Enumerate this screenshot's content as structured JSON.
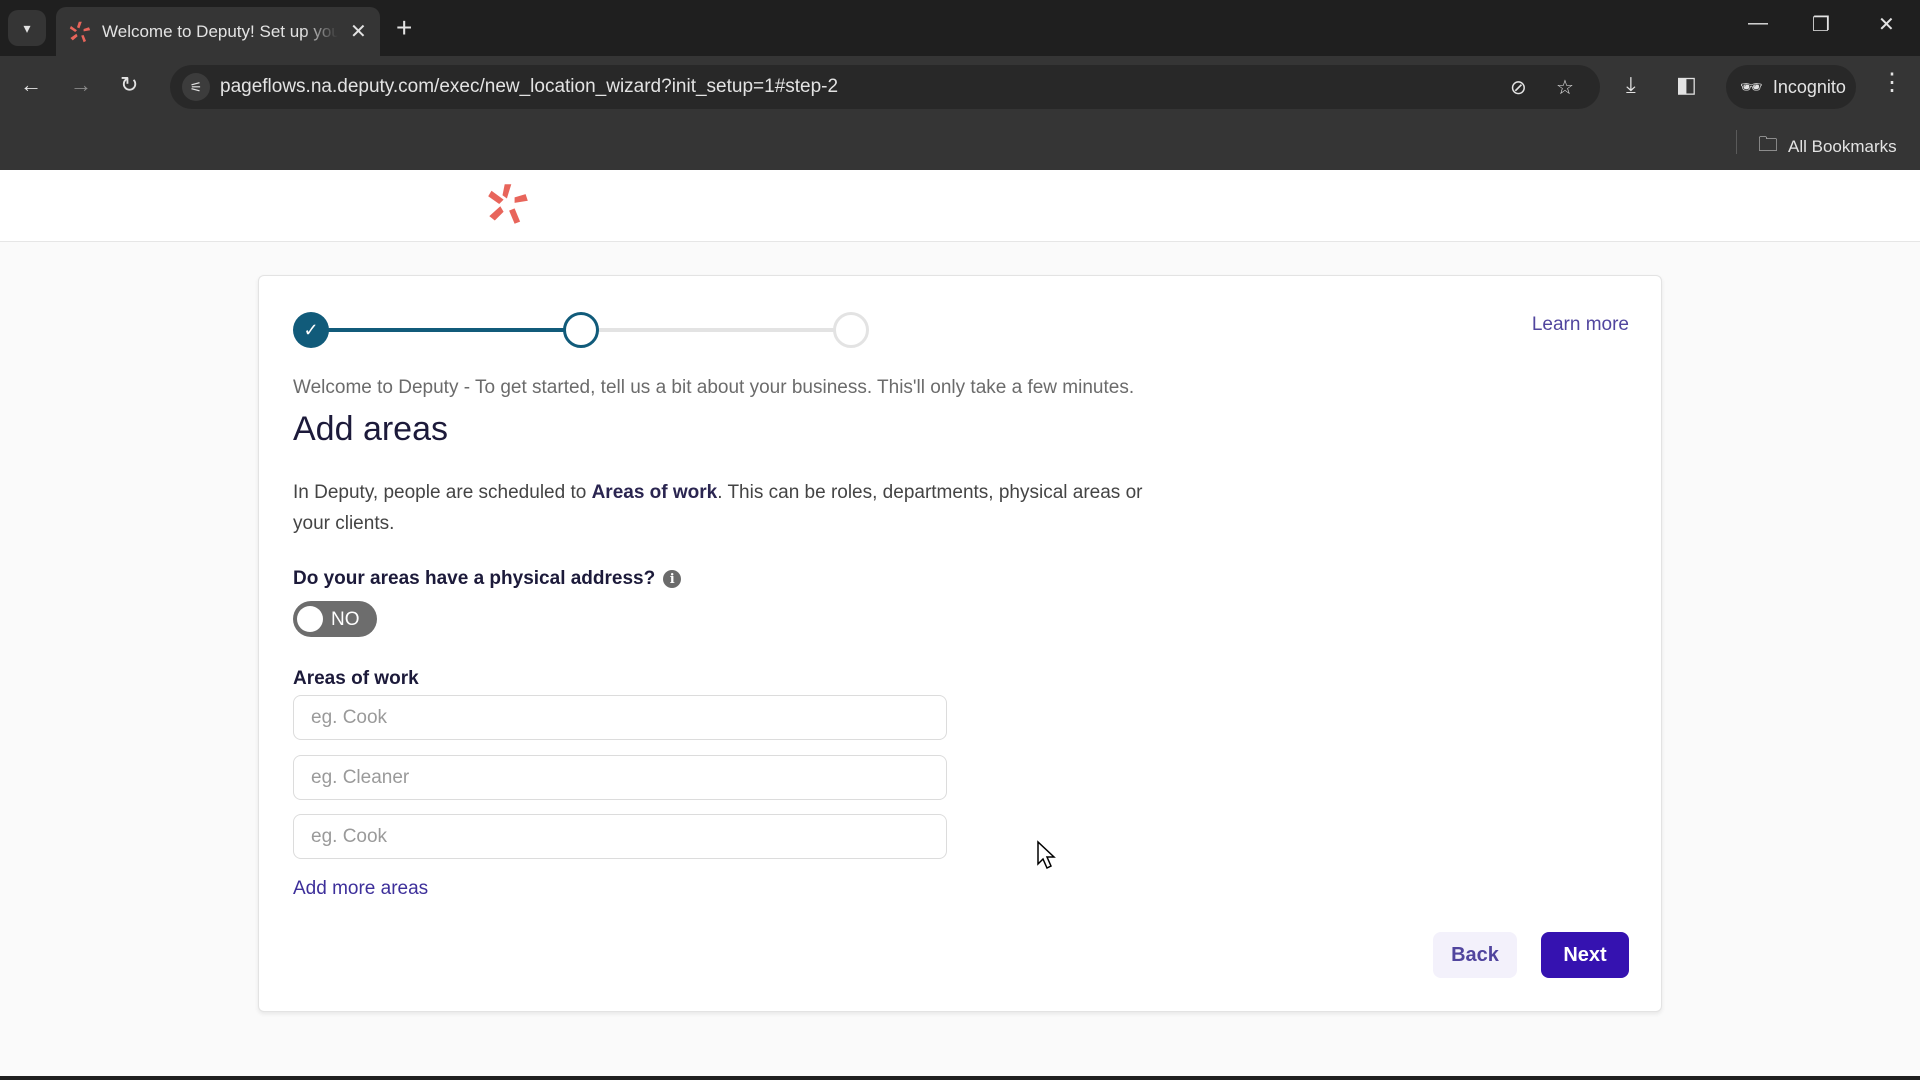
{
  "browser": {
    "tab": {
      "title": "Welcome to Deputy! Set up your",
      "favicon": "deputy-logo-icon"
    },
    "url": "pageflows.na.deputy.com/exec/new_location_wizard?init_setup=1#step-2",
    "incognito_label": "Incognito",
    "bookmarks_label": "All Bookmarks",
    "icons": {
      "tab_list": "▾",
      "close": "✕",
      "new_tab": "+",
      "minimize": "—",
      "restore": "❐",
      "window_close": "✕",
      "back": "←",
      "forward": "→",
      "reload": "↻",
      "site_info": "⚟",
      "eye_off": "⊘",
      "star": "☆",
      "download": "⤓",
      "side_panel": "◧",
      "incognito": "🕶",
      "menu": "⋮",
      "folder": "🗀"
    }
  },
  "wizard": {
    "steps": [
      {
        "state": "done",
        "icon": "✓"
      },
      {
        "state": "current"
      },
      {
        "state": "todo"
      }
    ],
    "learn_more": "Learn more",
    "intro": "Welcome to Deputy - To get started, tell us a bit about your business. This'll only take a few minutes.",
    "title": "Add areas",
    "description_prefix": "In Deputy, people are scheduled to ",
    "description_bold": "Areas of work",
    "description_suffix": ". This can be roles, departments, physical areas or your clients.",
    "question": "Do your areas have a physical address?",
    "info_icon": "i",
    "toggle": {
      "label": "NO",
      "on": false
    },
    "areas_label": "Areas of work",
    "inputs": [
      {
        "value": "",
        "placeholder": "eg. Cook"
      },
      {
        "value": "",
        "placeholder": "eg. Cleaner"
      },
      {
        "value": "",
        "placeholder": "eg. Cook"
      }
    ],
    "add_more": "Add more areas",
    "back_label": "Back",
    "next_label": "Next"
  },
  "colors": {
    "brand_logo": "#e8655b",
    "stepper": "#115b7a",
    "primary_button": "#3512b0",
    "link": "#51459e"
  }
}
